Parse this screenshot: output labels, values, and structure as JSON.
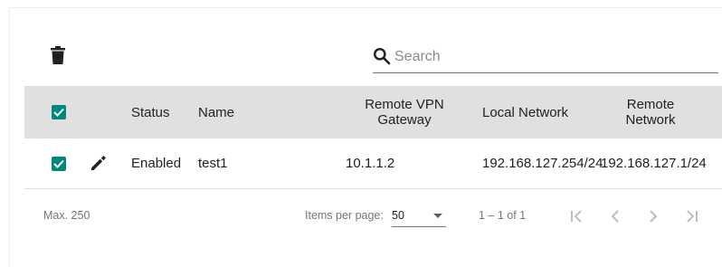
{
  "toolbar": {
    "delete_icon": "trash-icon",
    "search": {
      "placeholder": "Search",
      "value": "",
      "icon": "search-icon"
    }
  },
  "table": {
    "columns": [
      "Status",
      "Name",
      "Remote VPN Gateway",
      "Local Network",
      "Remote Network"
    ],
    "header_lines": {
      "remote_vpn_gateway": [
        "Remote VPN",
        "Gateway"
      ],
      "remote_network": [
        "Remote",
        "Network"
      ]
    },
    "select_all_checked": true,
    "rows": [
      {
        "checked": true,
        "status": "Enabled",
        "name": "test1",
        "remote_vpn_gateway": "10.1.1.2",
        "local_network": "192.168.127.254/24",
        "remote_network": "192.168.127.1/24"
      }
    ]
  },
  "footer": {
    "max_label": "Max. 250",
    "items_per_page_label": "Items per page:",
    "items_per_page_value": "50",
    "range_label": "1 – 1 of 1"
  },
  "colors": {
    "accent": "#00897b",
    "header_bg": "#e0e0e0",
    "muted": "#757575"
  }
}
